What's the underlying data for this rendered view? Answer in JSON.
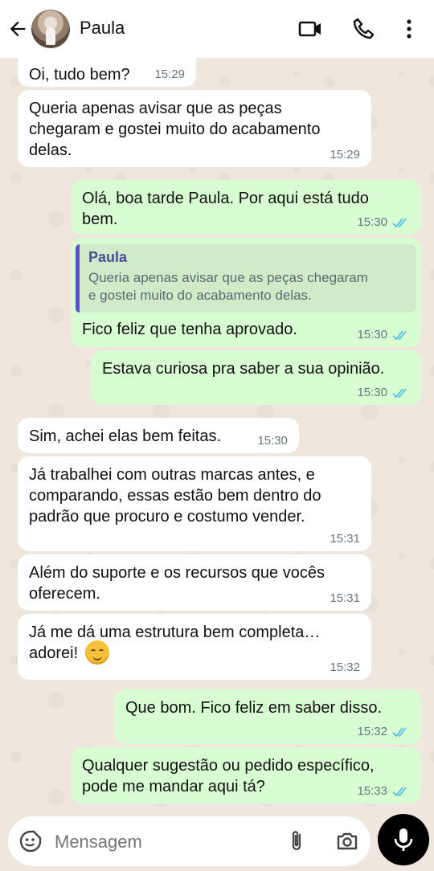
{
  "header": {
    "contact_name": "Paula"
  },
  "messages": [
    {
      "dir": "in",
      "text": "Oi, tudo bem?",
      "time": "15:29"
    },
    {
      "dir": "in",
      "text": "Queria apenas avisar que as peças\nchegaram e gostei muito do acabamento\ndelas.",
      "time": "15:29"
    },
    {
      "dir": "out",
      "text": "Olá, boa tarde Paula. Por aqui está tudo\nbem.",
      "time": "15:30"
    },
    {
      "dir": "out",
      "quote_name": "Paula",
      "quote_text": "Queria apenas avisar que as peças chegaram\ne gostei muito do acabamento delas.",
      "text": "Fico feliz que tenha aprovado.",
      "time": "15:30"
    },
    {
      "dir": "out",
      "text": "Estava curiosa pra saber a sua opinião.",
      "time": "15:30"
    },
    {
      "dir": "in",
      "text": "Sim, achei elas bem feitas.",
      "time": "15:30"
    },
    {
      "dir": "in",
      "text": "Já trabalhei com outras marcas antes, e\ncomparando, essas estão bem dentro do\npadrão que procuro e costumo vender.",
      "time": "15:31"
    },
    {
      "dir": "in",
      "text": "Além do suporte e os recursos que vocês\noferecem.",
      "time": "15:31"
    },
    {
      "dir": "in",
      "text": "Já me dá uma estrutura bem completa…\nadorei!",
      "emoji": "smiling-face",
      "time": "15:32"
    },
    {
      "dir": "out",
      "text": "Que bom. Fico feliz em saber disso.",
      "time": "15:32"
    },
    {
      "dir": "out",
      "text": "Qualquer sugestão ou pedido específico,\npode me mandar aqui tá?",
      "time": "15:33"
    }
  ],
  "composer": {
    "placeholder": "Mensagem"
  },
  "colors": {
    "incoming_bubble": "#ffffff",
    "outgoing_bubble": "#d9fdd3",
    "read_ticks": "#53bdeb",
    "quote_bar": "#5a4fcf"
  },
  "icons": [
    "back-arrow-icon",
    "video-call-icon",
    "phone-icon",
    "more-options-icon",
    "sticker-icon",
    "attach-icon",
    "camera-icon",
    "mic-icon",
    "double-check-icon"
  ]
}
